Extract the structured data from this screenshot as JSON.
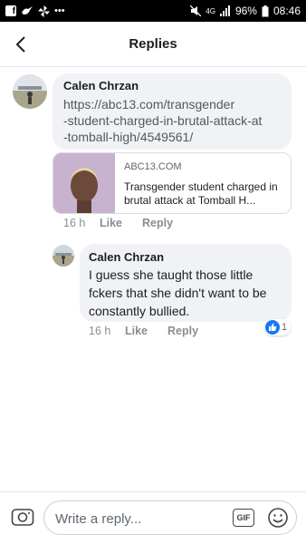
{
  "status_bar": {
    "left_icons": [
      "facebook-icon",
      "bird-icon",
      "pinwheel-icon",
      "more-dots-icon"
    ],
    "network": "4G",
    "battery": "96%",
    "time": "08:46"
  },
  "header": {
    "title": "Replies"
  },
  "comment": {
    "author": "Calen Chrzan",
    "link": "https://abc13.com/transgender-student-charged-in-brutal-attack-at-tomball-high/4549561/",
    "link_lines": [
      "https://abc13.com/transgender",
      "-student-charged-in-brutal-attack-at",
      "-tomball-high/4549561/"
    ],
    "preview": {
      "domain": "ABC13.COM",
      "title": "Transgender student charged in brutal attack at Tomball H..."
    },
    "time": "16 h",
    "like_label": "Like",
    "reply_label": "Reply"
  },
  "reply": {
    "author": "Calen Chrzan",
    "text": "I guess she taught those little fckers that she didn't want to be constantly bullied.",
    "time": "16 h",
    "like_label": "Like",
    "reply_label": "Reply",
    "reaction_count": "1"
  },
  "composer": {
    "placeholder": "Write a reply...",
    "gif_label": "GIF"
  },
  "colors": {
    "bubble": "#f0f2f5",
    "accent": "#1877f2",
    "secondary_text": "#8a8d91"
  }
}
